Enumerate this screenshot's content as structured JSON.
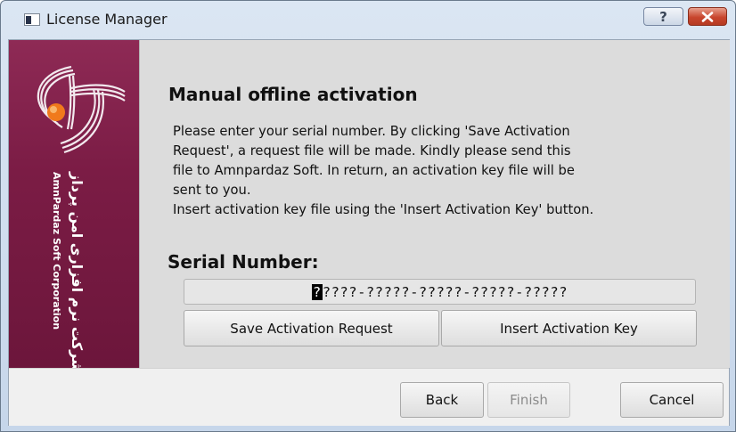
{
  "window": {
    "title": "License Manager",
    "help_label": "?",
    "close_icon": "close-icon",
    "app_icon": "window-app-icon",
    "accent_close": "#c8462e"
  },
  "banner": {
    "company_en": "AmnPardaz Soft Corporation",
    "company_fa": "شرکت نرم افزاری امن پرداز",
    "logo": "amnpardaz-logo",
    "bg_color": "#7b1c45"
  },
  "main": {
    "heading": "Manual offline activation",
    "description_lines": [
      "Please enter your serial number. By clicking 'Save Activation",
      "Request', a request file will be made. Kindly please send this",
      "file to Amnpardaz Soft. In return, an activation key file will be",
      "sent to you.",
      "Insert activation key file using the 'Insert Activation Key' button."
    ],
    "serial_label": "Serial Number:",
    "serial_caret": "?",
    "serial_value": "????-?????-?????-?????-?????",
    "save_label": "Save Activation Request",
    "insert_label": "Insert Activation Key"
  },
  "footer": {
    "back_label": "Back",
    "finish_label": "Finish",
    "cancel_label": "Cancel"
  }
}
